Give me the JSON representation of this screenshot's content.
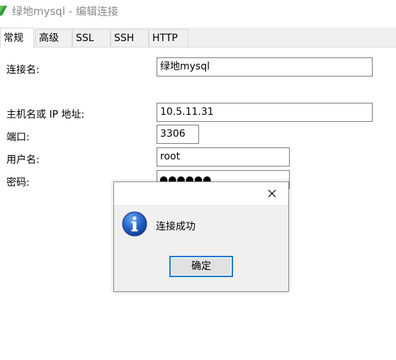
{
  "window": {
    "title": "绿地mysql - 编辑连接",
    "icon": "navicat-leaf-icon",
    "accent_color": "#2e9c3c"
  },
  "tabs": [
    {
      "label": "常规",
      "active": true
    },
    {
      "label": "高级",
      "active": false
    },
    {
      "label": "SSL",
      "active": false
    },
    {
      "label": "SSH",
      "active": false
    },
    {
      "label": "HTTP",
      "active": false
    }
  ],
  "form": {
    "connection_name": {
      "label": "连接名:",
      "value": "绿地mysql"
    },
    "host": {
      "label": "主机名或 IP 地址:",
      "value": "10.5.11.31"
    },
    "port": {
      "label": "端口:",
      "value": "3306"
    },
    "username": {
      "label": "用户名:",
      "value": "root"
    },
    "password": {
      "label": "密码:",
      "masked_value": "●●●●●●"
    }
  },
  "dialog": {
    "message": "连接成功",
    "icon": "info-icon",
    "ok_label": "确定",
    "close_icon": "close-icon",
    "button_focus_color": "#1a78d0",
    "icon_color": "#1f64c8"
  }
}
